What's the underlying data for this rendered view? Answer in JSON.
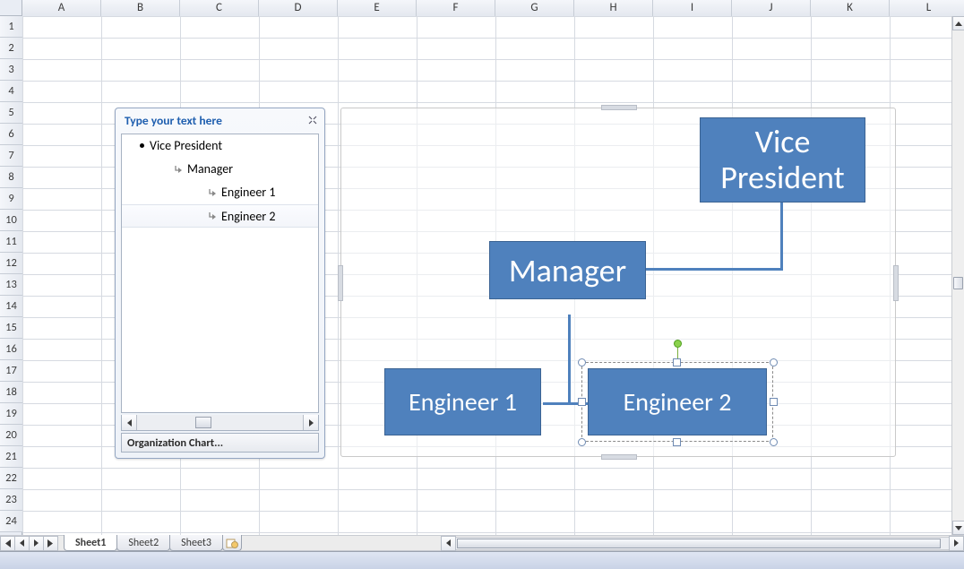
{
  "columns": [
    "A",
    "B",
    "C",
    "D",
    "E",
    "F",
    "G",
    "H",
    "I",
    "J",
    "K",
    "L"
  ],
  "rows": [
    "1",
    "2",
    "3",
    "4",
    "5",
    "6",
    "7",
    "8",
    "9",
    "10",
    "11",
    "12",
    "13",
    "14",
    "15",
    "16",
    "17",
    "18",
    "19",
    "20",
    "21",
    "22",
    "23",
    "24"
  ],
  "textpane": {
    "title": "Type your text here",
    "items": [
      {
        "level": 0,
        "label": "Vice President"
      },
      {
        "level": 1,
        "label": "Manager"
      },
      {
        "level": 2,
        "label": "Engineer 1"
      },
      {
        "level": 2,
        "label": "Engineer 2",
        "selected": true
      }
    ],
    "footer": "Organization Chart..."
  },
  "chart_data": {
    "type": "org",
    "nodes": [
      {
        "id": "vp",
        "label": "Vice\nPresident",
        "parent": null
      },
      {
        "id": "mgr",
        "label": "Manager",
        "parent": "vp"
      },
      {
        "id": "e1",
        "label": "Engineer 1",
        "parent": "mgr"
      },
      {
        "id": "e2",
        "label": "Engineer 2",
        "parent": "mgr",
        "selected": true
      }
    ]
  },
  "tabs": {
    "items": [
      "Sheet1",
      "Sheet2",
      "Sheet3"
    ],
    "active": "Sheet1"
  }
}
